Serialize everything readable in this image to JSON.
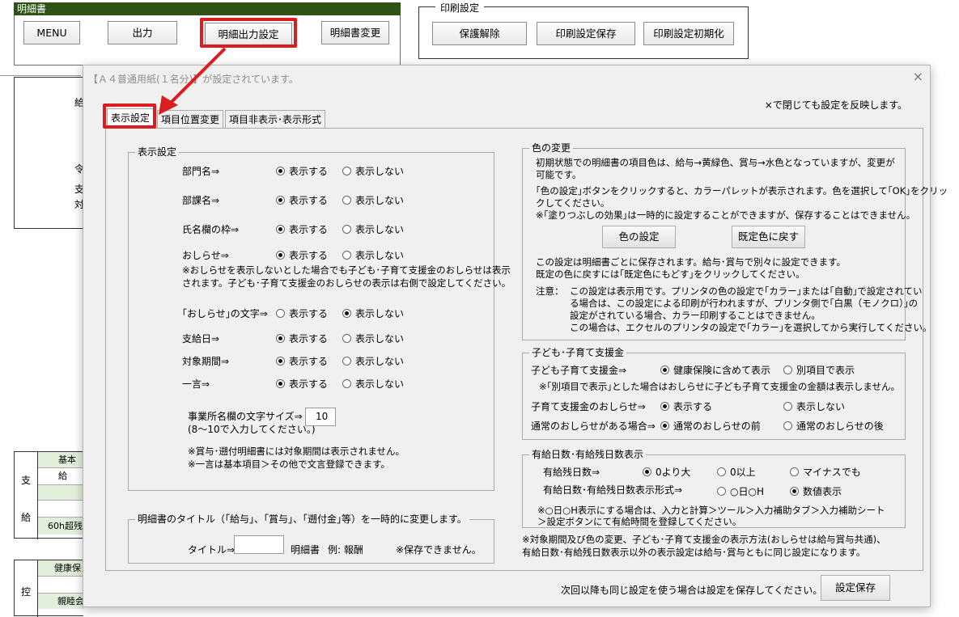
{
  "sheet": {
    "header_title": "明細書",
    "buttons": {
      "menu": "MENU",
      "output": "出力",
      "detail_output_settings": "明細出力設定",
      "change_statement": "明細書変更"
    },
    "print_settings": {
      "legend": "印刷設定",
      "unprotect": "保護解除",
      "save": "印刷設定保存",
      "reset": "印刷設定初期化"
    },
    "left_fragments": {
      "r1": "給",
      "r2": "令",
      "r3": "支",
      "r4": "対"
    },
    "table1": {
      "side1": "支",
      "side2": "給",
      "row1": "基本給",
      "row5": "60h超残"
    },
    "table2": {
      "side": "控",
      "row1": "健康保",
      "row2": "親睦会"
    }
  },
  "dialog": {
    "title": "【Ａ４普通用紙(１名分)】が設定されています。",
    "close": "×",
    "note": "×で閉じても設定を反映します。",
    "tabs": [
      "表示設定",
      "項目位置変更",
      "項目非表示･表示形式"
    ],
    "display": {
      "title": "表示設定",
      "show": "表示する",
      "hide": "表示しない",
      "rows": [
        {
          "label": "部門名⇒",
          "selected": "show"
        },
        {
          "label": "部課名⇒",
          "selected": "show"
        },
        {
          "label": "氏名欄の枠⇒",
          "selected": "show"
        },
        {
          "label": "おしらせ⇒",
          "selected": "show"
        },
        {
          "label": "｢おしらせ｣の文字⇒",
          "selected": "hide"
        },
        {
          "label": "支給日⇒",
          "selected": "show"
        },
        {
          "label": "対象期間⇒",
          "selected": "show"
        },
        {
          "label": "一言⇒",
          "selected": "show"
        }
      ],
      "oshirase_note1": "※おしらせを表示しないとした場合でも子ども･子育て支援金のおしらせは表示",
      "oshirase_note2": "されます。子ども･子育て支援金のおしらせの表示は右側で設定してください。",
      "font_size_label": "事業所名欄の文字サイズ⇒",
      "font_size_hint": "(8～10で入力してください。)",
      "font_size_value": "10",
      "note1": "※賞与･遡付明細書には対象期間は表示されません。",
      "note2": "※一言は基本項目＞その他で文言登録できます。"
    },
    "title_group": {
      "title": "明細書のタイトル（｢給与｣、｢賞与｣、｢遡付金｣等）を一時的に変更します。",
      "label": "タイトル⇒",
      "value": "",
      "suffix": "明細書",
      "example": "例:  報酬",
      "warning": "※保存できません。"
    },
    "color": {
      "title": "色の変更",
      "l1": "初期状態での明細書の項目色は、給与→黄緑色、賞与→水色となっていますが、変更が",
      "l2": "可能です。",
      "l3": "｢色の設定｣ボタンをクリックすると、カラーパレットが表示されます。色を選択して｢OK｣をクリッ",
      "l4": "クしてください。",
      "l5": "※｢塗りつぶしの効果｣は一時的に設定することができますが、保存することはできません。",
      "btn_set": "色の設定",
      "btn_default": "既定色に戻す",
      "l6": "この設定は明細書ごとに保存されます。給与･賞与で別々に設定できます。",
      "l7": "既定の色に戻すには｢既定色にもどす｣をクリックしてください。",
      "caution_label": "注意：",
      "c1": "この設定は表示用です。プリンタの色の設定で｢カラー｣または｢自動｣で設定されてい",
      "c2": "る場合は、この設定による印刷が行われますが、プリンタ側で｢白黒（モノクロ）｣の",
      "c3": "設定がされている場合、カラー印刷することはできません。",
      "c4": "この場合は、エクセルのプリンタの設定で｢カラー｣を選択してから実行してください。"
    },
    "kodomo": {
      "title": "子ども･子育て支援金",
      "r1_label": "子ども子育て支援金⇒",
      "r1_opt1": "健康保険に含めて表示",
      "r1_opt2": "別項目で表示",
      "note": "※｢別項目で表示｣とした場合はおしらせに子ども子育て支援金の金額は表示しません。",
      "r2_label": "子育て支援金のおしらせ⇒",
      "r2_opt1": "表示する",
      "r2_opt2": "表示しない",
      "r3_label": "通常のおしらせがある場合⇒",
      "r3_opt1": "通常のおしらせの前",
      "r3_opt2": "通常のおしらせの後"
    },
    "yukyu": {
      "title": "有給日数･有給残日数表示",
      "r1_label": "有給残日数⇒",
      "r1_opt1": "0より大",
      "r1_opt2": "0以上",
      "r1_opt3": "マイナスでも",
      "r2_label": "有給日数･有給残日数表示形式⇒",
      "r2_opt1": "○日○H",
      "r2_opt2": "数値表示",
      "n1": "※○日○H表示にする場合は、入力と計算＞ツール＞入力補助タブ＞入力補助シート",
      "n2": "＞設定ボタンにて有給時間を登録してください。"
    },
    "foot1": "※対象期間及び色の変更、子ども･子育て支援金の表示方法(おしらせは給与賞与共通)、",
    "foot2": "有給日数･有給残日数表示以外の表示設定は給与･賞与ともに同じ設定になります。",
    "save_note": "次回以降も同じ設定を使う場合は設定を保存してください。⇒",
    "save_btn": "設定保存"
  },
  "colors": {
    "highlight": "#d81e1e",
    "sheet_header": "#2f5317",
    "sheet_cell": "#e2efda"
  }
}
